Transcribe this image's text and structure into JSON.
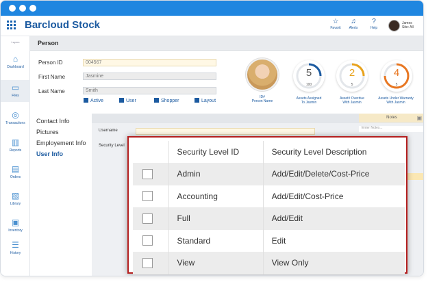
{
  "header": {
    "app_title": "Barcloud Stock",
    "actions": [
      {
        "label": "Favorit",
        "icon": "star-icon"
      },
      {
        "label": "Alerts",
        "icon": "bell-icon"
      },
      {
        "label": "Help",
        "icon": "question-icon"
      }
    ],
    "user_name": "James",
    "user_site": "Site:  All"
  },
  "sidebar": {
    "top_label": "Layers",
    "items": [
      {
        "label": "Dashboard",
        "icon": "home-icon"
      },
      {
        "label": "Files",
        "icon": "folder-icon"
      },
      {
        "label": "Transactions",
        "icon": "transfer-icon"
      },
      {
        "label": "Reports",
        "icon": "report-icon"
      },
      {
        "label": "Orders",
        "icon": "orders-icon"
      },
      {
        "label": "Library",
        "icon": "library-icon"
      },
      {
        "label": "Inventory",
        "icon": "inventory-icon"
      },
      {
        "label": "History",
        "icon": "history-icon"
      }
    ]
  },
  "page": {
    "title": "Person"
  },
  "form": {
    "person_id_label": "Person ID",
    "person_id_value": "004567",
    "first_name_label": "First Name",
    "first_name_value": "Jasmine",
    "last_name_label": "Last Name",
    "last_name_value": "Smith",
    "checkboxes": [
      "Active",
      "User",
      "Shopper",
      "Layout"
    ]
  },
  "profile": {
    "label_line1": "ID#",
    "label_line2": "Person Name"
  },
  "stats": [
    {
      "value": "5",
      "sub": "100",
      "label_line1": "Assets Assigned",
      "label_line2": "To Jasmin",
      "color": "#1b5aa0"
    },
    {
      "value": "2",
      "sub": "5",
      "label_line1": "Asset# Overdue",
      "label_line2": "With Jasmin",
      "color": "#e8a21c"
    },
    {
      "value": "4",
      "sub": "5",
      "label_line1": "Assets Under Warranty",
      "label_line2": "With Jasmin",
      "color": "#e87722"
    }
  ],
  "subnav": {
    "items": [
      "Contact Info",
      "Pictures",
      "Employement Info",
      "User Info"
    ]
  },
  "user_info": {
    "username_label": "Username",
    "security_label": "Security Level"
  },
  "notes": {
    "title": "Notes",
    "placeholder": "Enter Notes..."
  },
  "popup": {
    "columns": [
      "Security Level ID",
      "Security Level Description"
    ],
    "rows": [
      {
        "id": "Admin",
        "description": "Add/Edit/Delete/Cost-Price"
      },
      {
        "id": "Accounting",
        "description": "Add/Edit/Cost-Price"
      },
      {
        "id": "Full",
        "description": "Add/Edit"
      },
      {
        "id": "Standard",
        "description": "Edit"
      },
      {
        "id": "View",
        "description": "View Only"
      }
    ]
  }
}
